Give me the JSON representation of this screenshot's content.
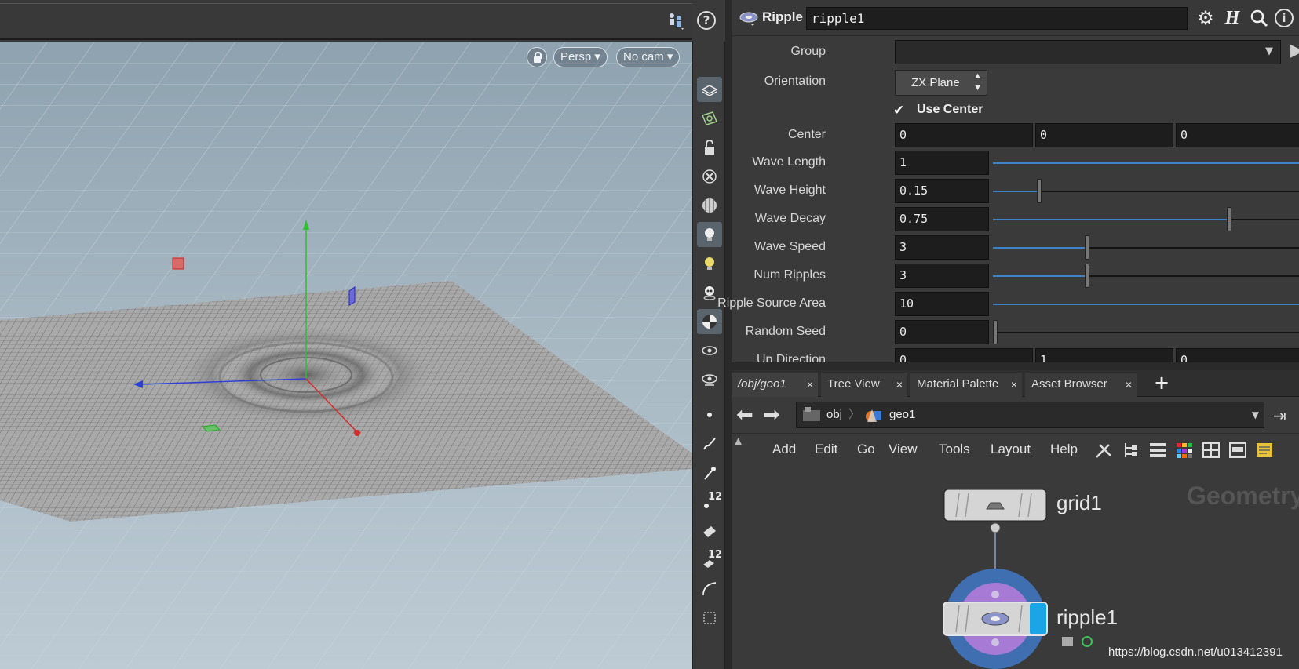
{
  "viewport": {
    "camera_mode": "Persp",
    "camera": "No cam"
  },
  "toolbar": {
    "counter_a": "12",
    "counter_b": "12"
  },
  "params": {
    "node_type": "Ripple",
    "node_name": "ripple1",
    "group_label": "Group",
    "group_value": "",
    "orientation_label": "Orientation",
    "orientation_value": "ZX Plane",
    "use_center_label": "Use Center",
    "center_label": "Center",
    "center": [
      "0",
      "0",
      "0"
    ],
    "wave_length_label": "Wave Length",
    "wave_length": "1",
    "wave_height_label": "Wave Height",
    "wave_height": "0.15",
    "wave_decay_label": "Wave Decay",
    "wave_decay": "0.75",
    "wave_speed_label": "Wave Speed",
    "wave_speed": "3",
    "num_ripples_label": "Num Ripples",
    "num_ripples": "3",
    "ripple_source_area_label": "Ripple Source Area",
    "ripple_source_area": "10",
    "random_seed_label": "Random Seed",
    "random_seed": "0",
    "up_direction_label": "Up Direction",
    "up_direction": [
      "0",
      "1",
      "0"
    ]
  },
  "tabs": [
    {
      "label": "/obj/geo1"
    },
    {
      "label": "Tree View"
    },
    {
      "label": "Material Palette"
    },
    {
      "label": "Asset Browser"
    }
  ],
  "path": {
    "segments": [
      "obj",
      "geo1"
    ]
  },
  "menu": [
    "Add",
    "Edit",
    "Go",
    "View",
    "Tools",
    "Layout",
    "Help"
  ],
  "network": {
    "context_label": "Geometry",
    "nodes": [
      "grid1",
      "ripple1"
    ]
  },
  "watermark": "https://blog.csdn.net/u013412391",
  "colors": {
    "accent_blue": "#3a83c8",
    "display_flag": "#1aa6e6",
    "ring_blue": "#3f6fb0",
    "ring_purple": "#a77ad6"
  }
}
